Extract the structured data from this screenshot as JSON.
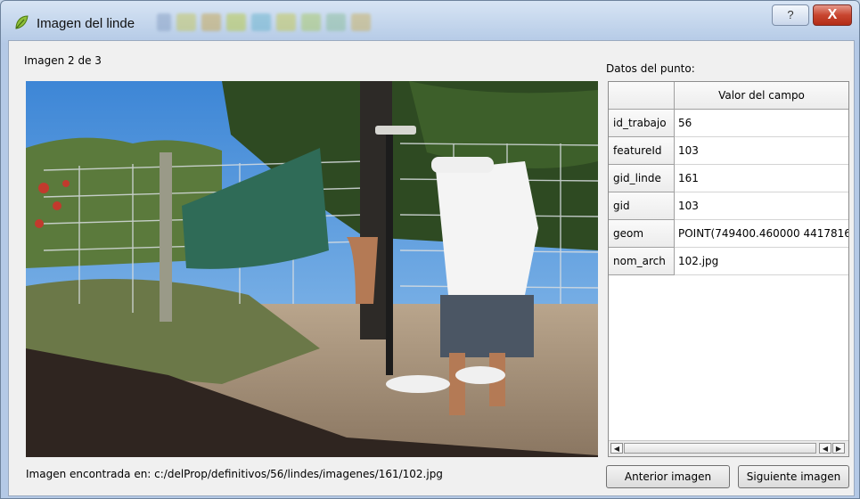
{
  "window": {
    "title": "Imagen del linde",
    "help_glyph": "?",
    "close_glyph": "X"
  },
  "main": {
    "image_counter": "Imagen 2 de 3",
    "point_data_label": "Datos del punto:",
    "image_path_text": "Imagen encontrada en: c:/delProp/definitivos/56/lindes/imagenes/161/102.jpg"
  },
  "table": {
    "column_header": "Valor del campo",
    "rows": [
      {
        "field": "id_trabajo",
        "value": "56"
      },
      {
        "field": "featureId",
        "value": "103"
      },
      {
        "field": "gid_linde",
        "value": "161"
      },
      {
        "field": "gid",
        "value": "103"
      },
      {
        "field": "geom",
        "value": "POINT(749400.460000 4417816"
      },
      {
        "field": "nom_arch",
        "value": "102.jpg"
      }
    ]
  },
  "buttons": {
    "previous": "Anterior imagen",
    "next": "Siguiente imagen"
  },
  "icons": {
    "app": "qgis-leaf-icon",
    "help": "help-icon",
    "close": "close-icon"
  }
}
